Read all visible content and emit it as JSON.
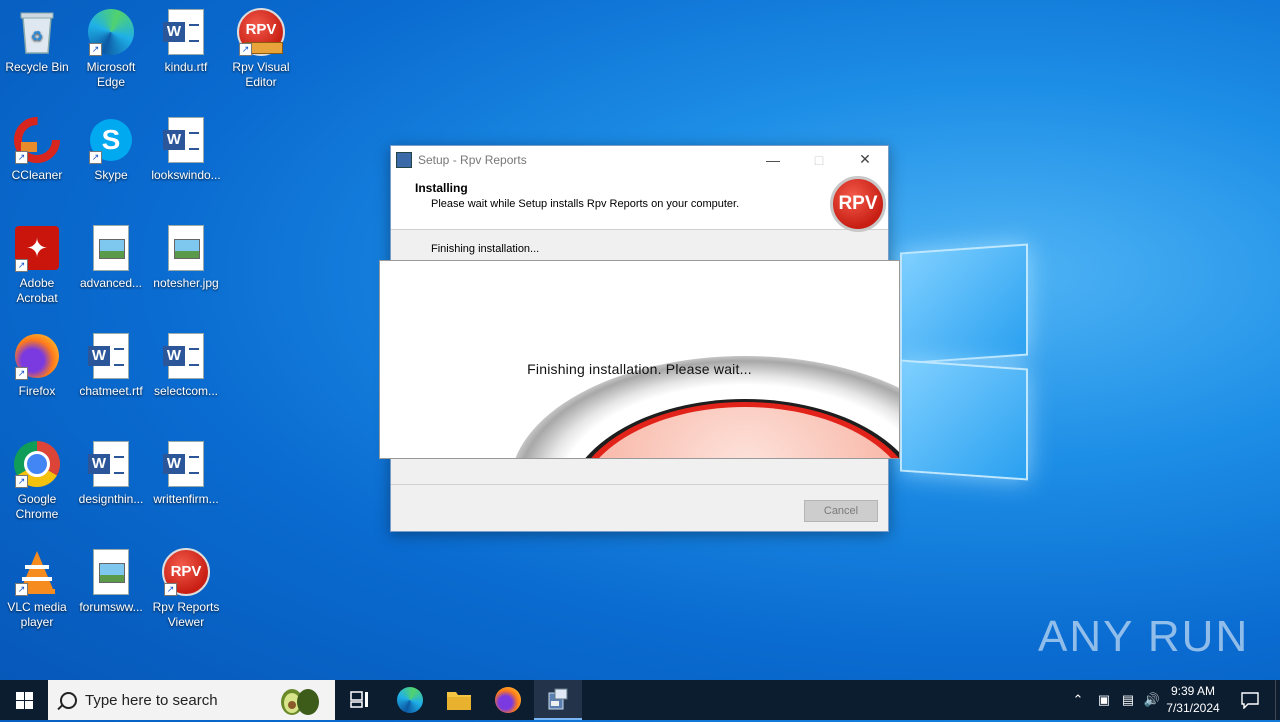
{
  "desktop": {
    "icons": [
      {
        "label": "Recycle Bin"
      },
      {
        "label": "Microsoft Edge"
      },
      {
        "label": "kindu.rtf"
      },
      {
        "label": "Rpv Visual Editor"
      },
      {
        "label": "CCleaner"
      },
      {
        "label": "Skype"
      },
      {
        "label": "lookswindo..."
      },
      {
        "label": "Adobe Acrobat"
      },
      {
        "label": "advanced..."
      },
      {
        "label": "notesher.jpg"
      },
      {
        "label": "Firefox"
      },
      {
        "label": "chatmeet.rtf"
      },
      {
        "label": "selectcom..."
      },
      {
        "label": "Google Chrome"
      },
      {
        "label": "designthin..."
      },
      {
        "label": "writtenfirm..."
      },
      {
        "label": "VLC media player"
      },
      {
        "label": "forumsww..."
      },
      {
        "label": "Rpv Reports Viewer"
      }
    ]
  },
  "setup": {
    "title": "Setup - Rpv Reports",
    "heading": "Installing",
    "subheading": "Please wait while Setup installs Rpv Reports on your computer.",
    "badge": "RPV",
    "status": "Finishing installation...",
    "cancel_label": "Cancel"
  },
  "splash": {
    "message": "Finishing installation. Please wait..."
  },
  "watermark": "ANY RUN",
  "taskbar": {
    "search_placeholder": "Type here to search",
    "time": "9:39 AM",
    "date": "7/31/2024"
  },
  "colors": {
    "desktop_blue": "#0a6bd0",
    "taskbar": "#0d1d30",
    "rpv_red": "#c81e14"
  }
}
